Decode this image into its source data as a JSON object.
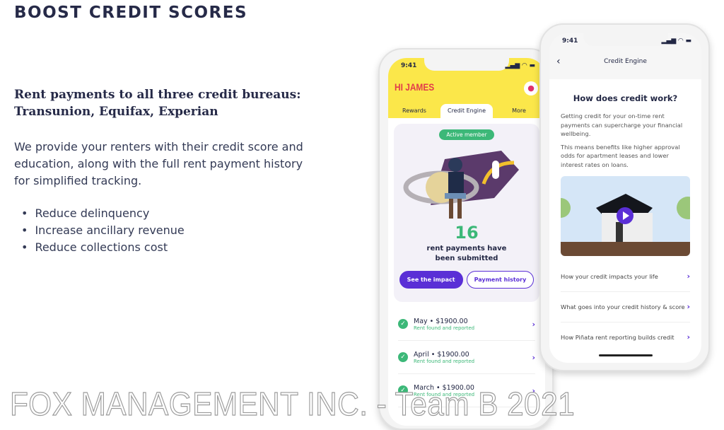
{
  "slide": {
    "title": "BOOST CREDIT SCORES",
    "subtitle": "Rent payments to all three credit bureaus: Transunion, Equifax, Experian",
    "paragraph": "We provide your renters with their credit score and education, along with the full rent payment history for simplified tracking.",
    "bullets": [
      "Reduce delinquency",
      "Increase ancillary revenue",
      "Reduce collections cost"
    ],
    "footer": "FOX MANAGEMENT INC. - Team B 2021"
  },
  "phone1": {
    "time": "9:41",
    "greeting": "HI JAMES",
    "tabs": [
      "Rewards",
      "Credit Engine",
      "More"
    ],
    "active_tab": "Credit Engine",
    "badge": "Active member",
    "count": "16",
    "message": "rent payments have been submitted",
    "primary_button": "See the impact",
    "secondary_button": "Payment history",
    "payments": [
      {
        "month": "May",
        "amount": "$1900.00",
        "status": "Rent found and reported"
      },
      {
        "month": "April",
        "amount": "$1900.00",
        "status": "Rent found and reported"
      },
      {
        "month": "March",
        "amount": "$1900.00",
        "status": "Rent found and reported"
      }
    ]
  },
  "phone2": {
    "time": "9:41",
    "nav_title": "Credit Engine",
    "heading": "How does credit work?",
    "p1": "Getting credit for your on-time rent payments can supercharge your financial wellbeing.",
    "p2": "This means benefits like higher approval odds for apartment leases and lower interest rates on loans.",
    "links": [
      "How your credit impacts your life",
      "What goes into your credit history & score",
      "How Piñata rent reporting builds credit"
    ]
  },
  "colors": {
    "yellow": "#fbe74a",
    "purple": "#5a2fd6",
    "green": "#3cb878",
    "navy": "#262a48"
  }
}
